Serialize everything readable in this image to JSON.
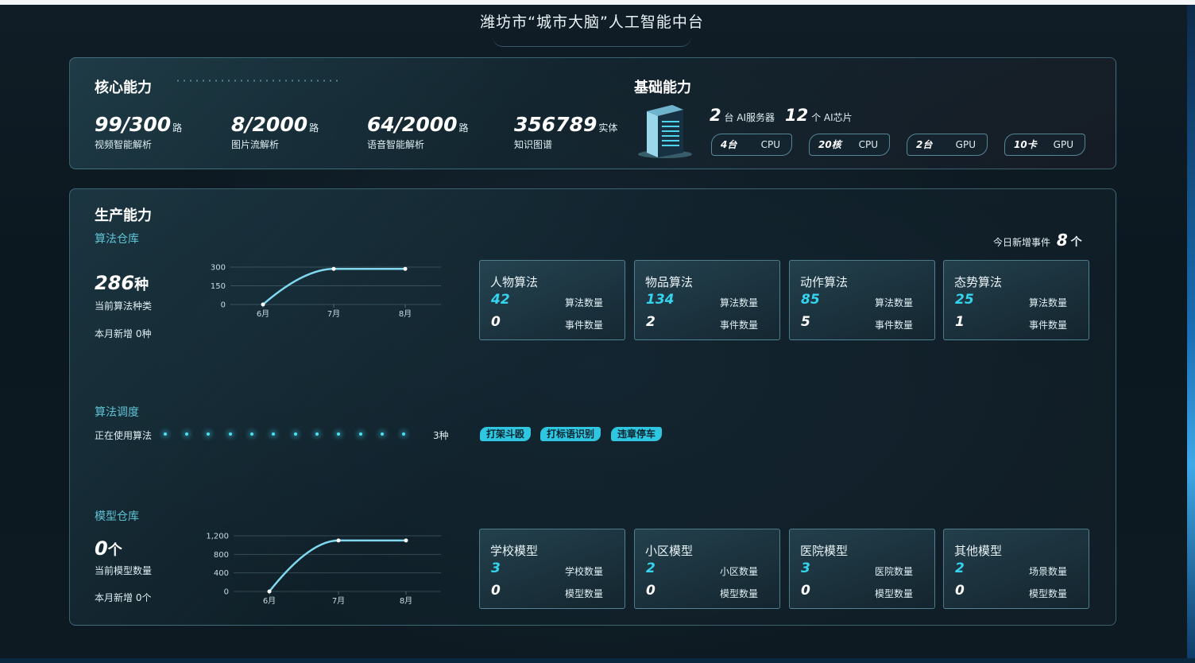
{
  "header": {
    "title": "潍坊市“城市大脑”人工智能中台"
  },
  "core": {
    "title": "核心能力",
    "stats": [
      {
        "value": "99/300",
        "unit": "路",
        "label": "视频智能解析"
      },
      {
        "value": "8/2000",
        "unit": "路",
        "label": "图片流解析"
      },
      {
        "value": "64/2000",
        "unit": "路",
        "label": "语音智能解析"
      },
      {
        "value": "356789",
        "unit": "实体",
        "label": "知识图谱"
      }
    ]
  },
  "base": {
    "title": "基础能力",
    "servers_value": "2",
    "servers_label": "台 AI服务器",
    "chips_value": "12",
    "chips_label": "个 AI芯片",
    "pills": [
      {
        "value": "4台",
        "type": "CPU"
      },
      {
        "value": "20核",
        "type": "CPU"
      },
      {
        "value": "2台",
        "type": "GPU"
      },
      {
        "value": "10卡",
        "type": "GPU"
      }
    ]
  },
  "production": {
    "title": "生产能力",
    "today_label": "今日新增事件",
    "today_value": "8",
    "today_unit": "个",
    "algo_repo": {
      "title": "算法仓库",
      "count": "286",
      "unit": "种",
      "count_label": "当前算法种类",
      "month_new": "本月新增 0种"
    },
    "algo_schedule": {
      "title": "算法调度",
      "label": "正在使用算法",
      "count": "3种",
      "tags": [
        "打架斗殴",
        "打标语识别",
        "违章停车"
      ]
    },
    "model_repo": {
      "title": "模型仓库",
      "count": "0",
      "unit": "个",
      "count_label": "当前模型数量",
      "month_new": "本月新增 0个"
    },
    "algo_cards": [
      {
        "title": "人物算法",
        "v1": "42",
        "l1": "算法数量",
        "v2": "0",
        "l2": "事件数量"
      },
      {
        "title": "物品算法",
        "v1": "134",
        "l1": "算法数量",
        "v2": "2",
        "l2": "事件数量"
      },
      {
        "title": "动作算法",
        "v1": "85",
        "l1": "算法数量",
        "v2": "5",
        "l2": "事件数量"
      },
      {
        "title": "态势算法",
        "v1": "25",
        "l1": "算法数量",
        "v2": "1",
        "l2": "事件数量"
      }
    ],
    "model_cards": [
      {
        "title": "学校模型",
        "v1": "3",
        "l1": "学校数量",
        "v2": "0",
        "l2": "模型数量"
      },
      {
        "title": "小区模型",
        "v1": "2",
        "l1": "小区数量",
        "v2": "0",
        "l2": "模型数量"
      },
      {
        "title": "医院模型",
        "v1": "3",
        "l1": "医院数量",
        "v2": "0",
        "l2": "模型数量"
      },
      {
        "title": "其他模型",
        "v1": "2",
        "l1": "场景数量",
        "v2": "0",
        "l2": "模型数量"
      }
    ]
  },
  "chart_data": [
    {
      "type": "line",
      "categories": [
        "6月",
        "7月",
        "8月"
      ],
      "values": [
        0,
        286,
        286
      ],
      "yticks": [
        "300",
        "150",
        "0"
      ],
      "ylim": [
        0,
        300
      ],
      "color": "#7fd8ee"
    },
    {
      "type": "line",
      "categories": [
        "6月",
        "7月",
        "8月"
      ],
      "values": [
        0,
        1100,
        1100
      ],
      "yticks": [
        "1,200",
        "800",
        "400",
        "0"
      ],
      "ylim": [
        0,
        1200
      ],
      "color": "#7fd8ee"
    }
  ]
}
